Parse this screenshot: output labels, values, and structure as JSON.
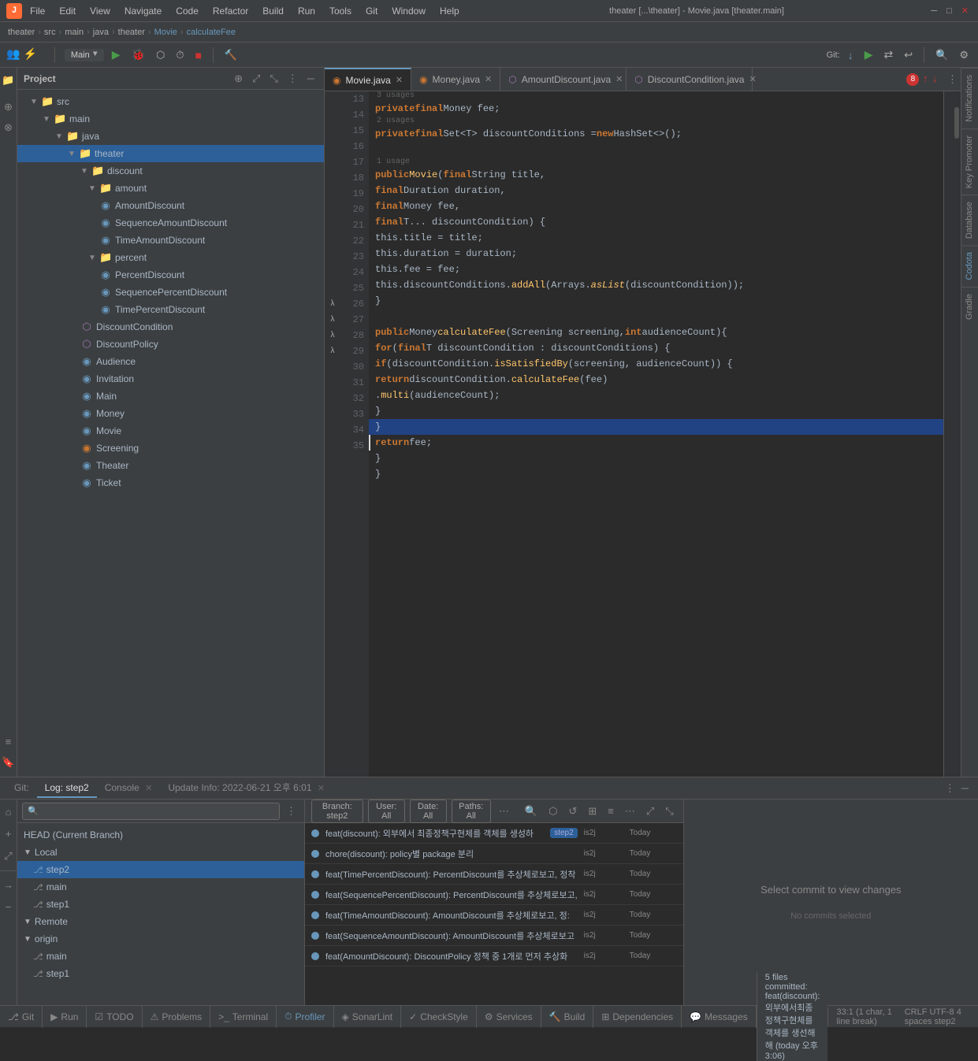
{
  "app": {
    "title": "theater [...\\theater] - Movie.java [theater.main]",
    "window_controls": [
      "minimize",
      "maximize",
      "close"
    ]
  },
  "menu": {
    "logo": "🔧",
    "items": [
      "File",
      "Edit",
      "View",
      "Navigate",
      "Code",
      "Refactor",
      "Build",
      "Run",
      "Tools",
      "Git",
      "Window",
      "Help"
    ]
  },
  "breadcrumb": {
    "items": [
      "theater",
      "src",
      "main",
      "java",
      "theater",
      "Movie",
      "calculateFee"
    ]
  },
  "toolbar": {
    "project_dropdown": "theater [...\\theater]",
    "main_config": "Main",
    "git_label": "Git:",
    "run_icon": "▶",
    "debug_icon": "🐛",
    "coverage_icon": "⬡",
    "profile_icon": "⏱"
  },
  "project_panel": {
    "title": "Project",
    "tree": [
      {
        "level": 1,
        "type": "folder",
        "label": "src",
        "expanded": true
      },
      {
        "level": 2,
        "type": "folder",
        "label": "main",
        "expanded": true
      },
      {
        "level": 3,
        "type": "folder",
        "label": "java",
        "expanded": true
      },
      {
        "level": 4,
        "type": "folder",
        "label": "theater",
        "expanded": true,
        "selected": true
      },
      {
        "level": 5,
        "type": "folder",
        "label": "discount",
        "expanded": true
      },
      {
        "level": 5,
        "type": "folder",
        "label": "amount",
        "expanded": true
      },
      {
        "level": 5,
        "type": "class",
        "label": "AmountDiscount"
      },
      {
        "level": 5,
        "type": "class",
        "label": "SequenceAmountDiscount"
      },
      {
        "level": 5,
        "type": "class",
        "label": "TimeAmountDiscount"
      },
      {
        "level": 5,
        "type": "folder",
        "label": "percent",
        "expanded": true
      },
      {
        "level": 5,
        "type": "class",
        "label": "PercentDiscount"
      },
      {
        "level": 5,
        "type": "class",
        "label": "SequencePercentDiscount"
      },
      {
        "level": 5,
        "type": "class",
        "label": "TimePercentDiscount"
      },
      {
        "level": 4,
        "type": "interface",
        "label": "DiscountCondition"
      },
      {
        "level": 4,
        "type": "interface",
        "label": "DiscountPolicy"
      },
      {
        "level": 4,
        "type": "class",
        "label": "Audience"
      },
      {
        "level": 4,
        "type": "class",
        "label": "Invitation"
      },
      {
        "level": 4,
        "type": "class",
        "label": "Main"
      },
      {
        "level": 4,
        "type": "class",
        "label": "Money"
      },
      {
        "level": 4,
        "type": "class",
        "label": "Movie"
      },
      {
        "level": 4,
        "type": "class-red",
        "label": "Screening"
      },
      {
        "level": 4,
        "type": "class",
        "label": "Theater"
      },
      {
        "level": 4,
        "type": "class",
        "label": "Ticket"
      }
    ]
  },
  "tabs": [
    {
      "id": "movie",
      "label": "Movie.java",
      "active": true,
      "type": "class"
    },
    {
      "id": "money",
      "label": "Money.java",
      "active": false,
      "type": "class"
    },
    {
      "id": "amount",
      "label": "AmountDiscount.java",
      "active": false,
      "type": "class"
    },
    {
      "id": "discount",
      "label": "DiscountCondition.java",
      "active": false,
      "type": "interface"
    }
  ],
  "code": {
    "lines": [
      {
        "num": 13,
        "usage": "3 usages",
        "content": "    private final Money fee;"
      },
      {
        "num": 14,
        "usage": "2 usages",
        "content": "    private final Set<T> discountConditions = new HashSet<>();"
      },
      {
        "num": 15,
        "content": ""
      },
      {
        "num": 16,
        "usage": "1 usage",
        "content": "    public Movie(final String title,"
      },
      {
        "num": 17,
        "content": "                 final Duration duration,"
      },
      {
        "num": 18,
        "content": "                 final Money fee,"
      },
      {
        "num": 19,
        "content": "                 final T... discountCondition) {"
      },
      {
        "num": 20,
        "content": "        this.title = title;"
      },
      {
        "num": 21,
        "content": "        this.duration = duration;"
      },
      {
        "num": 22,
        "content": "        this.fee = fee;"
      },
      {
        "num": 23,
        "content": "        this.discountConditions.addAll(Arrays.asList(discountCondition));"
      },
      {
        "num": 24,
        "content": "    }"
      },
      {
        "num": 25,
        "content": ""
      },
      {
        "num": 26,
        "content": "    public Money calculateFee(Screening screening, int audienceCount){"
      },
      {
        "num": 27,
        "content": "        for (final T discountCondition : discountConditions) {"
      },
      {
        "num": 28,
        "content": "            if (discountCondition.isSatisfiedBy(screening, audienceCount)) {"
      },
      {
        "num": 29,
        "content": "                return discountCondition.calculateFee(fee)"
      },
      {
        "num": 30,
        "content": "                        .multi(audienceCount);"
      },
      {
        "num": 31,
        "content": "            }"
      },
      {
        "num": 32,
        "content": "        }",
        "highlighted": true
      },
      {
        "num": 33,
        "content": "        return fee;",
        "cursor": true
      },
      {
        "num": 34,
        "content": "    }"
      },
      {
        "num": 35,
        "content": "}"
      }
    ]
  },
  "bottom_panel": {
    "tabs": [
      {
        "id": "git",
        "label": "Git:",
        "prefix": true,
        "active": false
      },
      {
        "id": "log",
        "label": "Log: step2",
        "active": false
      },
      {
        "id": "console",
        "label": "Console",
        "active": false,
        "closeable": true
      },
      {
        "id": "update_info",
        "label": "Update Info: 2022-06-21 오후 6:01",
        "active": false,
        "closeable": true
      }
    ],
    "git_tree": {
      "items": [
        {
          "label": "HEAD (Current Branch)",
          "level": 0
        },
        {
          "label": "Local",
          "level": 0,
          "expanded": true
        },
        {
          "label": "step2",
          "level": 1,
          "selected": true,
          "type": "branch"
        },
        {
          "label": "main",
          "level": 1,
          "type": "branch"
        },
        {
          "label": "step1",
          "level": 1,
          "type": "branch"
        },
        {
          "label": "Remote",
          "level": 0,
          "expanded": true
        },
        {
          "label": "origin",
          "level": 0,
          "expanded": true
        },
        {
          "label": "main",
          "level": 1,
          "type": "branch"
        },
        {
          "label": "step1",
          "level": 1,
          "type": "branch"
        }
      ]
    },
    "filter_bar": {
      "branch": "Branch: step2",
      "user": "User: All",
      "date": "Date: All",
      "paths": "Paths: All"
    },
    "commits": [
      {
        "msg": "feat(discount): 외부에서 최종정책구현체를 객체를 생성하",
        "badge": "step2",
        "author": "is2j",
        "date": "Today"
      },
      {
        "msg": "chore(discount): policy별 package 분리",
        "author": "is2j",
        "date": "Today"
      },
      {
        "msg": "feat(TimePercentDiscount): PercentDiscount를 추상체로보고, 정착",
        "author": "is2j",
        "date": "Today"
      },
      {
        "msg": "feat(SequencePercentDiscount): PercentDiscount를 추상체로보고,",
        "author": "is2j",
        "date": "Today"
      },
      {
        "msg": "feat(TimeAmountDiscount): AmountDiscount를 추상체로보고, 정:",
        "author": "is2j",
        "date": "Today"
      },
      {
        "msg": "feat(SequenceAmountDiscount): AmountDiscount를 추상체로보고",
        "author": "is2j",
        "date": "Today"
      },
      {
        "msg": "feat(AmountDiscount): DiscountPolicy 정책 중 1개로 먼저 추상화",
        "author": "is2j",
        "date": "Today"
      }
    ],
    "select_commit_msg": "Select commit to view changes",
    "no_commits_msg": "No commits selected"
  },
  "status_bar": {
    "git_branch": "Git",
    "run_btn": "Run",
    "todo_btn": "TODO",
    "problems_btn": "Problems",
    "terminal_btn": "Terminal",
    "profiler_btn": "Profiler",
    "sonar_btn": "SonarLint",
    "checkstyle_btn": "CheckStyle",
    "services_btn": "Services",
    "build_btn": "Build",
    "dependencies_btn": "Dependencies",
    "messages_btn": "Messages",
    "status_text": "5 files committed: feat(discount): 외부에서최종정책구현체를 객체를 생선해해  (today 오후 3:06)",
    "position": "33:1 (1 char, 1 line break)",
    "encoding": "CRLF  UTF-8  4 spaces  step2"
  },
  "right_panels": [
    "Notifications",
    "Key Promoter",
    "Database",
    "Codota",
    "Gradle"
  ],
  "error_count": "8"
}
